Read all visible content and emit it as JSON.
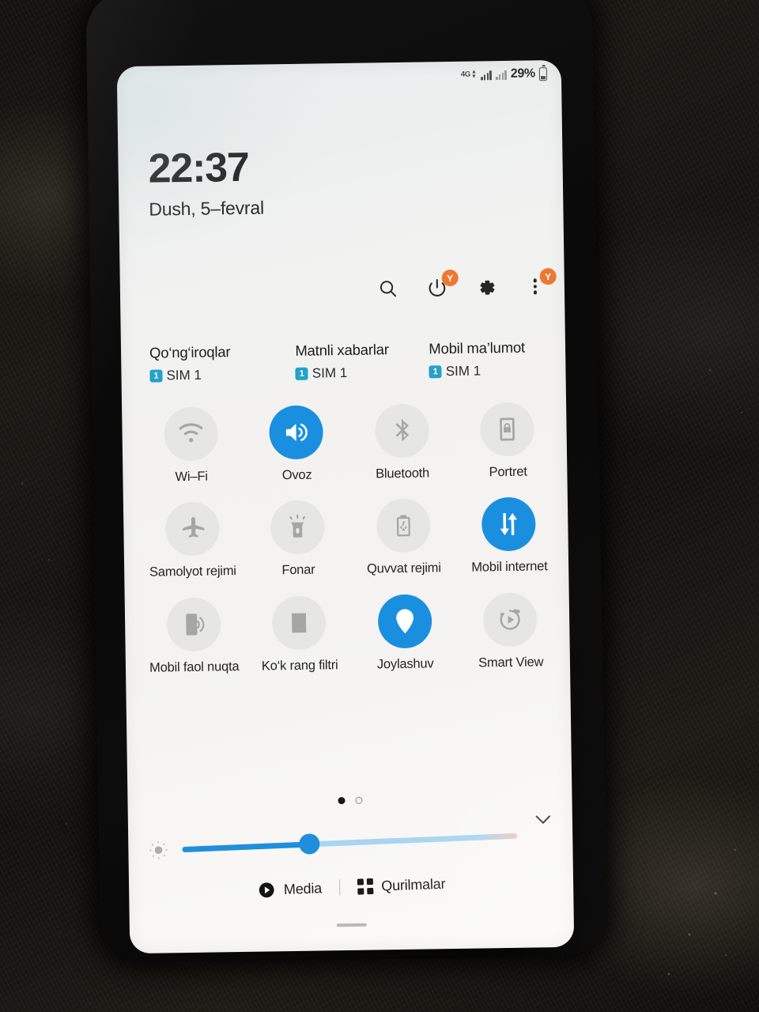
{
  "device": {
    "type": "smartphone-photo",
    "surface": "quick-settings-panel"
  },
  "status_bar": {
    "network_type": "4G",
    "data_arrows": "↓↑",
    "signal_sim1": "signal-bars-icon",
    "signal_sim2": "signal-bars-icon",
    "battery_percent": "29%",
    "battery_icon": "battery-icon"
  },
  "clock": {
    "time": "22:37",
    "date": "Dush, 5–fevral"
  },
  "header_actions": [
    {
      "name": "search",
      "icon": "search-icon",
      "badge": null
    },
    {
      "name": "power",
      "icon": "power-icon",
      "badge": "Y"
    },
    {
      "name": "settings",
      "icon": "gear-icon",
      "badge": null
    },
    {
      "name": "more",
      "icon": "kebab-menu-icon",
      "badge": "Y"
    }
  ],
  "sim_status": [
    {
      "title": "Qo‘ng‘iroqlar",
      "badge": "1",
      "label": "SIM 1"
    },
    {
      "title": "Matnli xabarlar",
      "badge": "1",
      "label": "SIM 1"
    },
    {
      "title": "Mobil ma’lumot",
      "badge": "1",
      "label": "SIM 1"
    }
  ],
  "toggles": [
    {
      "label": "Wi–Fi",
      "icon": "wifi-icon",
      "state": "off"
    },
    {
      "label": "Ovoz",
      "icon": "sound-icon",
      "state": "on"
    },
    {
      "label": "Bluetooth",
      "icon": "bluetooth-icon",
      "state": "off"
    },
    {
      "label": "Portret",
      "icon": "screen-rotation-icon",
      "state": "off"
    },
    {
      "label": "Samolyot rejimi",
      "icon": "airplane-icon",
      "state": "off"
    },
    {
      "label": "Fonar",
      "icon": "flashlight-icon",
      "state": "off"
    },
    {
      "label": "Quvvat rejimi",
      "icon": "power-saving-icon",
      "state": "off"
    },
    {
      "label": "Mobil internet",
      "icon": "mobile-data-icon",
      "state": "on"
    },
    {
      "label": "Mobil faol nuqta",
      "icon": "hotspot-icon",
      "state": "off"
    },
    {
      "label": "Ko‘k rang filtri",
      "icon": "blue-light-filter-icon",
      "state": "off"
    },
    {
      "label": "Joylashuv",
      "icon": "location-pin-icon",
      "state": "on"
    },
    {
      "label": "Smart View",
      "icon": "smart-view-icon",
      "state": "off"
    }
  ],
  "pager": {
    "total_pages": 2,
    "current_page": 1
  },
  "brightness": {
    "icon": "brightness-icon",
    "value_percent": 38,
    "thumb_percent": 38
  },
  "footer": [
    {
      "label": "Media",
      "icon": "play-circle-icon"
    },
    {
      "label": "Qurilmalar",
      "icon": "grid-dots-icon"
    }
  ],
  "collapse_icon": "chevron-down-icon",
  "colors": {
    "accent_blue": "#1a8fe0",
    "badge_orange": "#ee7733",
    "sim_badge_blue": "#25a2c9",
    "tile_off_bg": "#e6e6e4",
    "tile_off_icon": "#a6a6a4",
    "screen_bg": "#f3f3f1",
    "text_primary": "#1d1d1d"
  }
}
